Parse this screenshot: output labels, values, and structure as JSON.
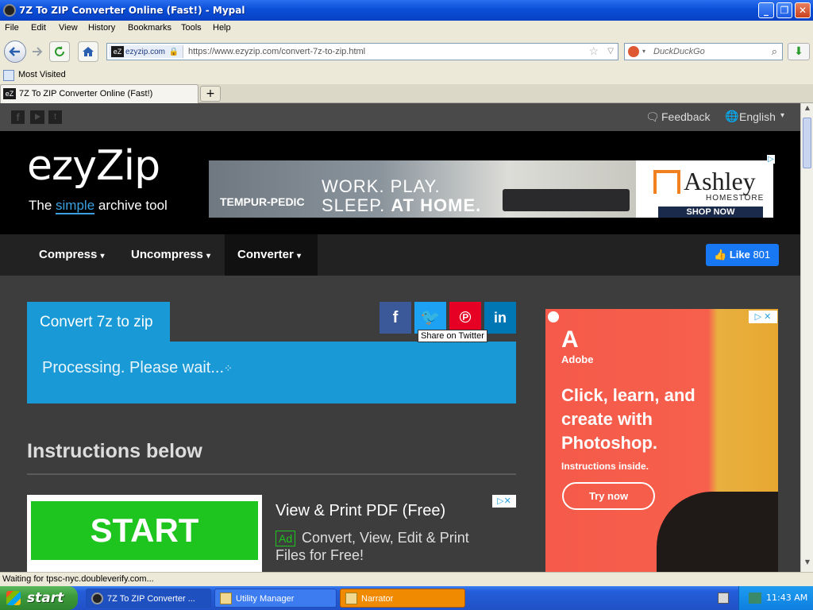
{
  "window": {
    "title": "7Z To ZIP Converter Online (Fast!) - Mypal"
  },
  "menu": [
    "File",
    "Edit",
    "View",
    "History",
    "Bookmarks",
    "Tools",
    "Help"
  ],
  "address": {
    "site_id": "ezyzip.com",
    "url": "https://www.ezyzip.com/convert-7z-to-zip.html"
  },
  "search": {
    "placeholder": "DuckDuckGo"
  },
  "bookmarks": {
    "most_visited": "Most Visited"
  },
  "tab": {
    "label": "7Z To ZIP Converter Online (Fast!)",
    "new_tab": "+"
  },
  "site": {
    "feedback": "Feedback",
    "language": "English",
    "logo_main": "ezyZip",
    "tagline_pre": "The",
    "tagline_em": "simple",
    "tagline_post": "archive tool",
    "nav": {
      "compress": "Compress",
      "uncompress": "Uncompress",
      "converter": "Converter"
    },
    "like": {
      "label": "Like",
      "count": "801"
    },
    "convert_tab": "Convert 7z to zip",
    "processing": "Processing. Please wait...",
    "tooltip": "Share on Twitter",
    "instructions": "Instructions below"
  },
  "ads": {
    "banner": {
      "brand": "TEMPUR-PEDIC",
      "line1": "WORK. PLAY.",
      "line2_pre": "SLEEP.",
      "line2_em": "AT HOME.",
      "ashley": "Ashley",
      "homestore": "HOMESTORE",
      "shop": "SHOP NOW"
    },
    "adobe": {
      "brand": "Adobe",
      "headline1": "Click, learn, and",
      "headline2": "create with",
      "headline3": "Photoshop.",
      "sub": "Instructions inside.",
      "cta": "Try now"
    },
    "pdf": {
      "start": "START",
      "title": "View & Print PDF (Free)",
      "badge": "Ad",
      "text1": "Convert, View, Edit & Print",
      "text2": "Files for Free!"
    }
  },
  "status": {
    "text": "Waiting for tpsc-nyc.doubleverify.com..."
  },
  "taskbar": {
    "start": "start",
    "tasks": [
      "7Z To ZIP Converter ...",
      "Utility Manager",
      "Narrator"
    ],
    "clock": "11:43 AM"
  }
}
